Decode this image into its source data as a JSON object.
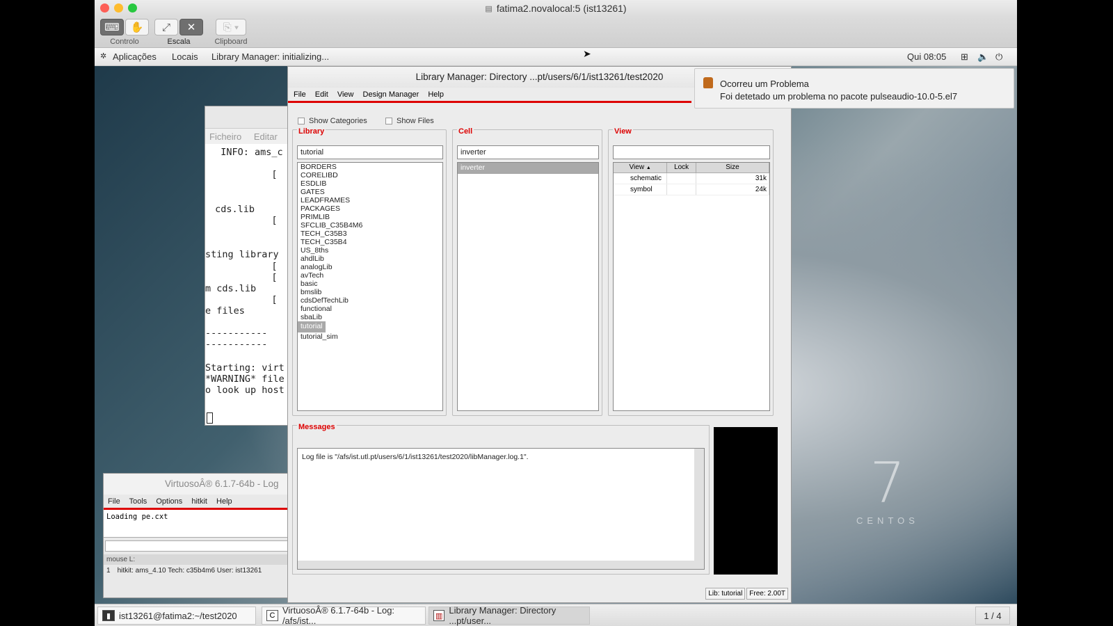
{
  "vm_window": {
    "title": "fatima2.novalocal:5 (ist13261)",
    "toolbar": {
      "controlo_label": "Controlo",
      "escala_label": "Escala",
      "clipboard_label": "Clipboard"
    }
  },
  "gnome_topbar": {
    "applications": "Aplicações",
    "places": "Locais",
    "active_app": "Library Manager: initializing...",
    "clock": "Qui 08:05"
  },
  "terminal": {
    "menu": [
      "Ficheiro",
      "Editar"
    ],
    "lines": [
      "  INFO: ams_c",
      "           [",
      " cds.lib",
      "           [",
      "sting library",
      "           [",
      "           [",
      "m cds.lib",
      "           [",
      "e files",
      "-----------",
      "-----------",
      "Starting: virt",
      "*WARNING* file",
      "o look up host"
    ]
  },
  "virtuoso": {
    "title": "VirtuosoÂ® 6.1.7-64b - Log",
    "menu": [
      "File",
      "Tools",
      "Options",
      "hitkit",
      "Help"
    ],
    "log_text": "Loading pe.cxt",
    "mouse_label": "mouse L:",
    "status_num": "1",
    "status_text": "hitkit: ams_4.10  Tech: c35b4m6  User: ist13261"
  },
  "library_manager": {
    "title": "Library Manager: Directory ...pt/users/6/1/ist13261/test2020",
    "menu": [
      "File",
      "Edit",
      "View",
      "Design Manager",
      "Help"
    ],
    "show_categories": "Show Categories",
    "show_files": "Show Files",
    "library_panel": {
      "title": "Library",
      "field_value": "tutorial",
      "items": [
        "BORDERS",
        "CORELIBD",
        "ESDLIB",
        "GATES",
        "LEADFRAMES",
        "PACKAGES",
        "PRIMLIB",
        "SFCLIB_C35B4M6",
        "TECH_C35B3",
        "TECH_C35B4",
        "US_8ths",
        "ahdlLib",
        "analogLib",
        "avTech",
        "basic",
        "bmslib",
        "cdsDefTechLib",
        "functional",
        "sbaLib",
        "tutorial",
        "tutorial_sim"
      ],
      "selected": "tutorial"
    },
    "cell_panel": {
      "title": "Cell",
      "field_value": "inverter",
      "items": [
        "inverter"
      ],
      "selected": "inverter"
    },
    "view_panel": {
      "title": "View",
      "field_value": "",
      "headers": [
        "View",
        "Lock",
        "Size"
      ],
      "rows": [
        {
          "view": "schematic",
          "lock": "",
          "size": "31k"
        },
        {
          "view": "symbol",
          "lock": "",
          "size": "24k"
        }
      ]
    },
    "messages": {
      "title": "Messages",
      "text": "Log file is \"/afs/ist.utl.pt/users/6/1/ist13261/test2020/libManager.log.1\"."
    },
    "status_lib": "Lib: tutorial",
    "status_free": "Free: 2.00T"
  },
  "notification": {
    "title": "Ocorreu um Problema",
    "body": "Foi detetado um problema no pacote pulseaudio-10.0-5.el7"
  },
  "desktop": {
    "logo_number": "7",
    "logo_word": "CENTOS"
  },
  "taskbar": {
    "items": [
      "ist13261@fatima2:~/test2020",
      "VirtuosoÂ® 6.1.7-64b - Log: /afs/ist...",
      "Library Manager: Directory ...pt/user..."
    ],
    "workspace": "1 / 4"
  },
  "colors": {
    "accent_red": "#dd0000",
    "selection_gray": "#a9a9a9"
  }
}
